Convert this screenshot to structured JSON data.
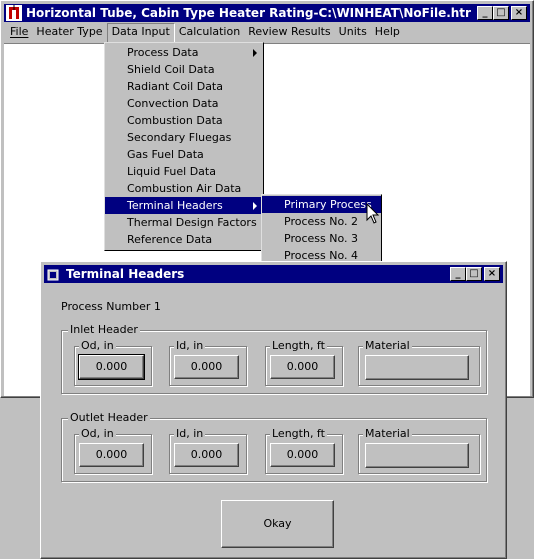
{
  "main_window": {
    "title": "Horizontal Tube, Cabin Type Heater Rating-C:\\WINHEAT\\NoFile.htr",
    "caption_buttons": {
      "minimize": "_",
      "maximize": "□",
      "close": "×"
    }
  },
  "menubar": {
    "items": [
      "File",
      "Heater Type",
      "Data Input",
      "Calculation",
      "Review Results",
      "Units",
      "Help"
    ],
    "active": "Data Input"
  },
  "data_input_menu": {
    "items": [
      {
        "label": "Process Data",
        "submenu": true
      },
      {
        "label": "Shield Coil Data",
        "submenu": false
      },
      {
        "label": "Radiant Coil Data",
        "submenu": false
      },
      {
        "label": "Convection Data",
        "submenu": false
      },
      {
        "label": "Combustion Data",
        "submenu": false
      },
      {
        "label": "Secondary Fluegas",
        "submenu": false
      },
      {
        "label": "Gas Fuel Data",
        "submenu": false
      },
      {
        "label": "Liquid Fuel Data",
        "submenu": false
      },
      {
        "label": "Combustion Air Data",
        "submenu": false
      },
      {
        "label": "Terminal Headers",
        "submenu": true
      },
      {
        "label": "Thermal Design Factors",
        "submenu": false
      },
      {
        "label": "Reference Data",
        "submenu": false
      }
    ],
    "selected": "Terminal Headers"
  },
  "terminal_headers_submenu": {
    "items": [
      "Primary Process",
      "Process No. 2",
      "Process No. 3",
      "Process No. 4"
    ],
    "selected": "Primary Process"
  },
  "dialog": {
    "title": "Terminal Headers",
    "process_label": "Process Number 1",
    "inlet": {
      "title": "Inlet Header",
      "od_label": "Od, in",
      "od_value": "0.000",
      "id_label": "Id, in",
      "id_value": "0.000",
      "length_label": "Length, ft",
      "length_value": "0.000",
      "material_label": "Material",
      "material_value": ""
    },
    "outlet": {
      "title": "Outlet Header",
      "od_label": "Od, in",
      "od_value": "0.000",
      "id_label": "Id, in",
      "id_value": "0.000",
      "length_label": "Length, ft",
      "length_value": "0.000",
      "material_label": "Material",
      "material_value": ""
    },
    "okay_label": "Okay"
  },
  "colors": {
    "title_bar": "#000080",
    "face": "#c0c0c0",
    "selection": "#000080",
    "client": "#ffffff"
  }
}
